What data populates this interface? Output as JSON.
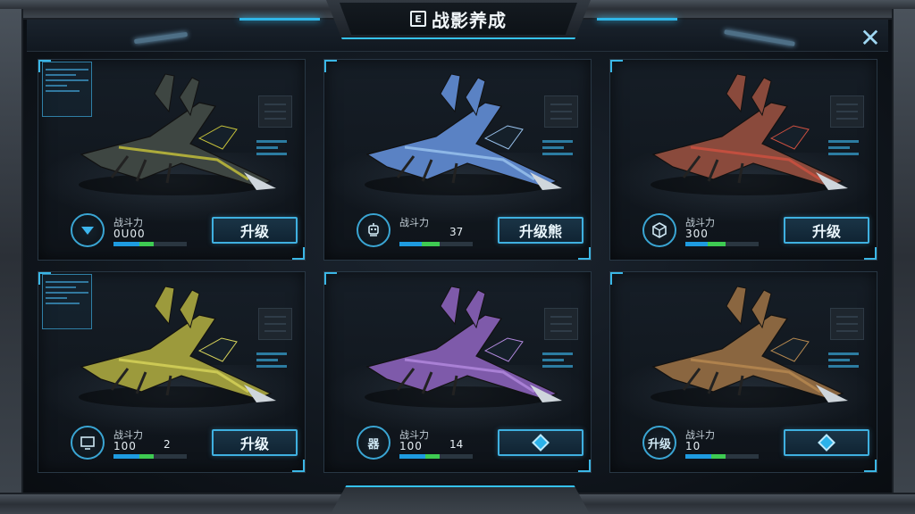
{
  "header": {
    "icon_glyph": "E",
    "title": "战影养成",
    "close_glyph": "✕"
  },
  "colors": {
    "accent": "#35c2f1",
    "bar_blue": "#1e9be0",
    "bar_green": "#3ecb52"
  },
  "cards": [
    {
      "jet_color": "#3e4642",
      "jet_stripe": "#c9c43a",
      "badge_icon": "triangle-icon",
      "badge_text": "",
      "stat_label": "战斗力",
      "stat_value": "0U00",
      "stat_extra": "",
      "progress_blue": 0.35,
      "progress_green": 0.2,
      "button_label": "升级",
      "button_icon": ""
    },
    {
      "jet_color": "#5a82c4",
      "jet_stripe": "#9bc4ef",
      "badge_icon": "robot-icon",
      "badge_text": "",
      "stat_label": "战斗力",
      "stat_value": "",
      "stat_extra": "37",
      "progress_blue": 0.3,
      "progress_green": 0.25,
      "button_label": "升级熊",
      "button_icon": ""
    },
    {
      "jet_color": "#8a4a3c",
      "jet_stripe": "#d05040",
      "badge_icon": "cube-icon",
      "badge_text": "",
      "stat_label": "战斗力",
      "stat_value": "300",
      "stat_extra": "",
      "progress_blue": 0.3,
      "progress_green": 0.25,
      "button_label": "升级",
      "button_icon": ""
    },
    {
      "jet_color": "#9c9a3c",
      "jet_stripe": "#d8d45a",
      "badge_icon": "monitor-icon",
      "badge_text": "",
      "stat_label": "战斗力",
      "stat_value": "100",
      "stat_extra": "2",
      "progress_blue": 0.35,
      "progress_green": 0.2,
      "button_label": "升级",
      "button_icon": ""
    },
    {
      "jet_color": "#7e5aaa",
      "jet_stripe": "#b48ae0",
      "badge_icon": "",
      "badge_text": "器",
      "stat_label": "战斗力",
      "stat_value": "100",
      "stat_extra": "14",
      "progress_blue": 0.35,
      "progress_green": 0.2,
      "button_label": "",
      "button_icon": "diamond-icon"
    },
    {
      "jet_color": "#8a6640",
      "jet_stripe": "#b88a50",
      "badge_icon": "",
      "badge_text": "升级",
      "stat_label": "战斗力",
      "stat_value": "10",
      "stat_extra": "",
      "progress_blue": 0.35,
      "progress_green": 0.2,
      "button_label": "",
      "button_icon": "diamond-icon"
    }
  ]
}
